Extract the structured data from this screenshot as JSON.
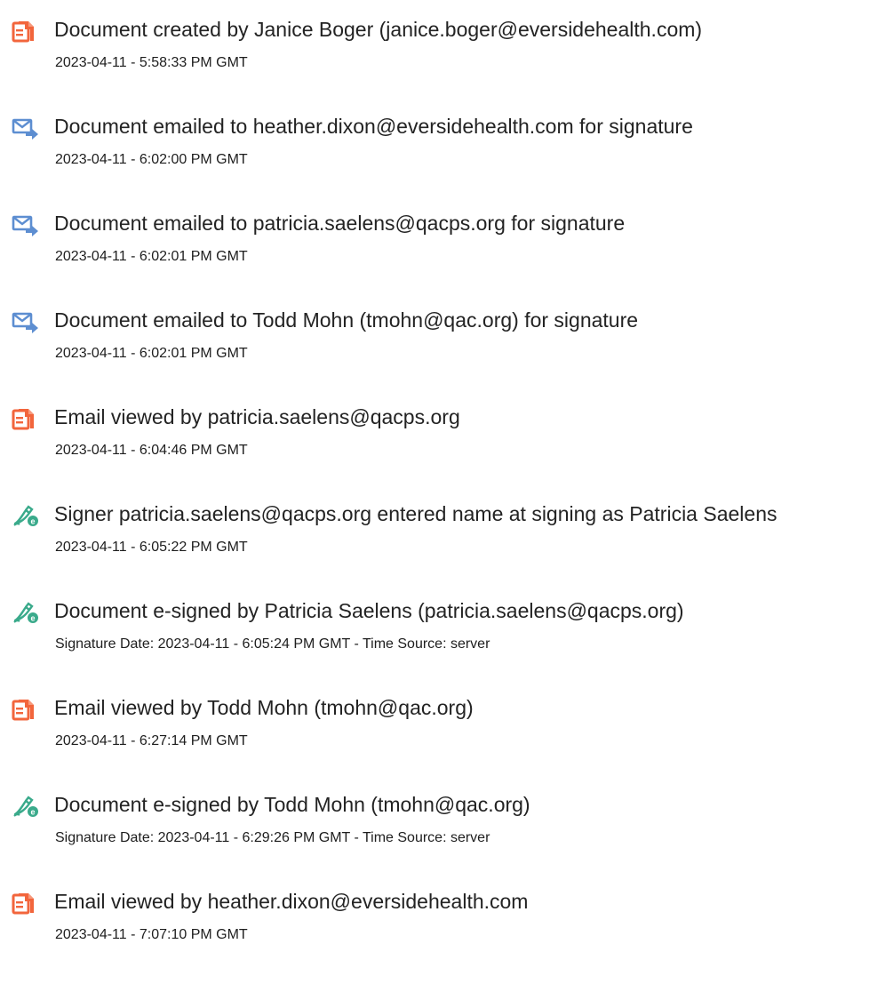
{
  "icons": {
    "document": "document-icon",
    "email": "email-send-icon",
    "signature": "e-sign-pen-icon"
  },
  "colors": {
    "document_icon": "#f2653c",
    "email_icon": "#5d8ed1",
    "signature_icon": "#3aaa8b"
  },
  "events": [
    {
      "icon": "document",
      "title": "Document created by Janice Boger (janice.boger@eversidehealth.com)",
      "time": "2023-04-11 - 5:58:33 PM GMT"
    },
    {
      "icon": "email",
      "title": "Document emailed to heather.dixon@eversidehealth.com for signature",
      "time": "2023-04-11 - 6:02:00 PM GMT"
    },
    {
      "icon": "email",
      "title": "Document emailed to patricia.saelens@qacps.org for signature",
      "time": "2023-04-11 - 6:02:01 PM GMT"
    },
    {
      "icon": "email",
      "title": "Document emailed to Todd Mohn (tmohn@qac.org) for signature",
      "time": "2023-04-11 - 6:02:01 PM GMT"
    },
    {
      "icon": "document",
      "title": "Email viewed by patricia.saelens@qacps.org",
      "time": "2023-04-11 - 6:04:46 PM GMT"
    },
    {
      "icon": "signature",
      "title": "Signer patricia.saelens@qacps.org entered name at signing as Patricia Saelens",
      "time": "2023-04-11 - 6:05:22 PM GMT"
    },
    {
      "icon": "signature",
      "title": "Document e-signed by Patricia Saelens (patricia.saelens@qacps.org)",
      "time": "Signature Date: 2023-04-11 - 6:05:24 PM GMT - Time Source: server"
    },
    {
      "icon": "document",
      "title": "Email viewed by Todd Mohn (tmohn@qac.org)",
      "time": "2023-04-11 - 6:27:14 PM GMT"
    },
    {
      "icon": "signature",
      "title": "Document e-signed by Todd Mohn (tmohn@qac.org)",
      "time": "Signature Date: 2023-04-11 - 6:29:26 PM GMT - Time Source: server"
    },
    {
      "icon": "document",
      "title": "Email viewed by heather.dixon@eversidehealth.com",
      "time": "2023-04-11 - 7:07:10 PM GMT"
    }
  ]
}
